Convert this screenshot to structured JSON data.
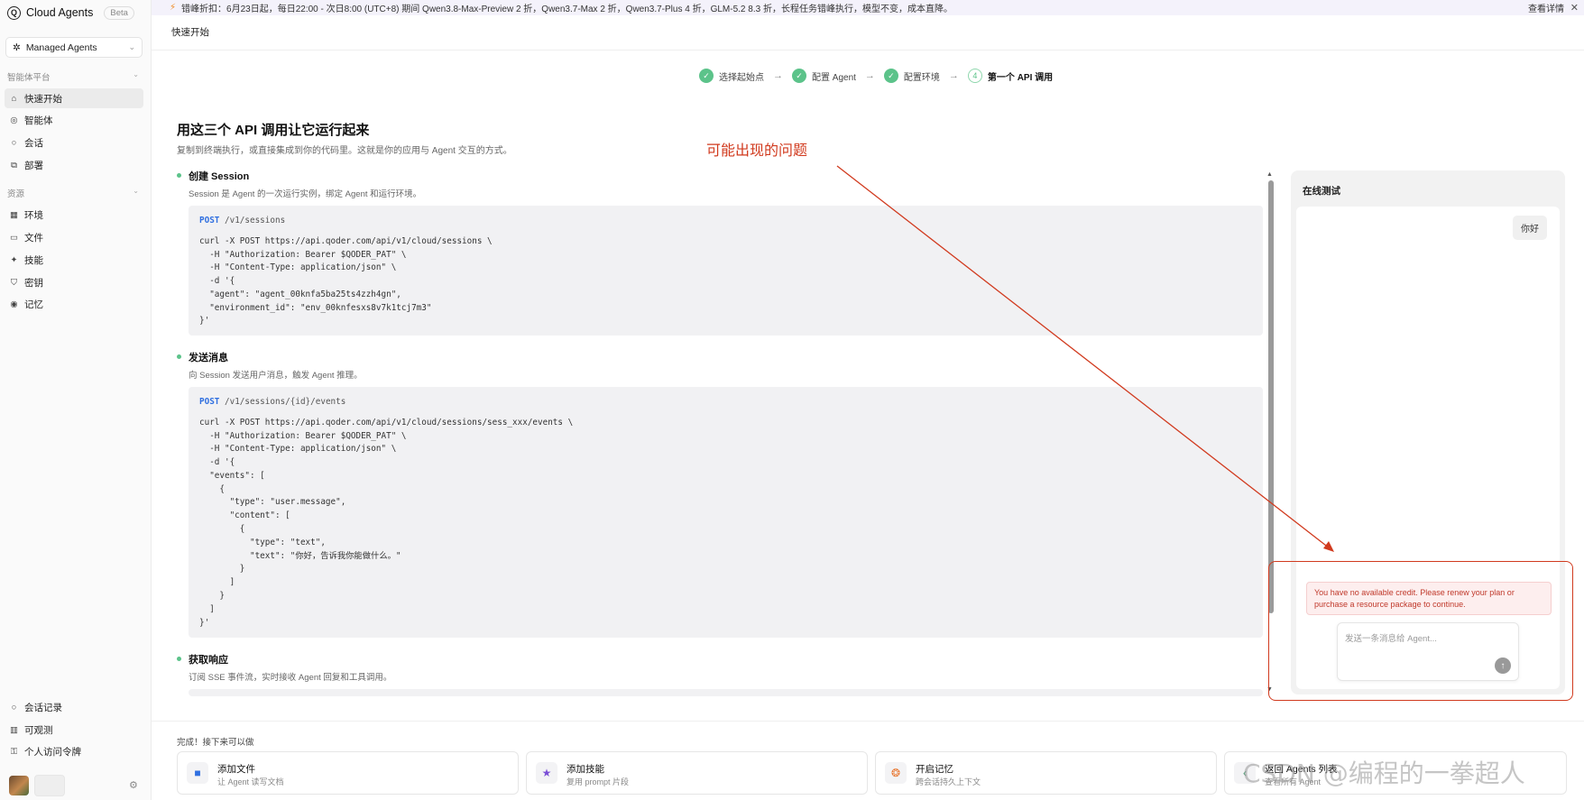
{
  "app": {
    "name": "Cloud Agents",
    "badge": "Beta"
  },
  "sidebar": {
    "workspace": "Managed Agents",
    "section1": "智能体平台",
    "items1": [
      {
        "label": "快速开始",
        "icon": "home-icon"
      },
      {
        "label": "智能体",
        "icon": "agent-icon"
      },
      {
        "label": "会话",
        "icon": "chat-icon"
      },
      {
        "label": "部署",
        "icon": "deploy-icon"
      }
    ],
    "section2": "资源",
    "items2": [
      {
        "label": "环境",
        "icon": "grid-icon"
      },
      {
        "label": "文件",
        "icon": "folder-icon"
      },
      {
        "label": "技能",
        "icon": "bulb-icon"
      },
      {
        "label": "密钥",
        "icon": "shield-icon"
      },
      {
        "label": "记忆",
        "icon": "memory-icon"
      }
    ],
    "bottom_items": [
      {
        "label": "会话记录",
        "icon": "chat-icon"
      },
      {
        "label": "可观测",
        "icon": "chart-icon"
      },
      {
        "label": "个人访问令牌",
        "icon": "key-icon"
      }
    ]
  },
  "banner": {
    "text": "错峰折扣：6月23日起，每日22:00 - 次日8:00 (UTC+8) 期间 Qwen3.8-Max-Preview 2 折，Qwen3.7-Max 2 折，Qwen3.7-Plus 4 折，GLM-5.2 8.3 折，长程任务错峰执行，模型不变，成本直降。",
    "detail": "查看详情"
  },
  "page_title": "快速开始",
  "stepper": [
    {
      "label": "选择起始点",
      "done": true
    },
    {
      "label": "配置 Agent",
      "done": true
    },
    {
      "label": "配置环境",
      "done": true
    },
    {
      "label": "第一个 API 调用",
      "num": "4",
      "done": false
    }
  ],
  "main": {
    "title": "用这三个 API 调用让它运行起来",
    "subtitle": "复制到终端执行，或直接集成到你的代码里。这就是你的应用与 Agent 交互的方式。",
    "steps": [
      {
        "title": "创建 Session",
        "desc": "Session 是 Agent 的一次运行实例，绑定 Agent 和运行环境。",
        "method": "POST",
        "path": "/v1/sessions",
        "code": "curl -X POST https://api.qoder.com/api/v1/cloud/sessions \\\n  -H \"Authorization: Bearer $QODER_PAT\" \\\n  -H \"Content-Type: application/json\" \\\n  -d '{\n  \"agent\": \"agent_00knfa5ba25ts4zzh4gn\",\n  \"environment_id\": \"env_00knfesxs8v7k1tcj7m3\"\n}'"
      },
      {
        "title": "发送消息",
        "desc": "向 Session 发送用户消息，触发 Agent 推理。",
        "method": "POST",
        "path": "/v1/sessions/{id}/events",
        "code": "curl -X POST https://api.qoder.com/api/v1/cloud/sessions/sess_xxx/events \\\n  -H \"Authorization: Bearer $QODER_PAT\" \\\n  -H \"Content-Type: application/json\" \\\n  -d '{\n  \"events\": [\n    {\n      \"type\": \"user.message\",\n      \"content\": [\n        {\n          \"type\": \"text\",\n          \"text\": \"你好，告诉我你能做什么。\"\n        }\n      ]\n    }\n  ]\n}'"
      },
      {
        "title": "获取响应",
        "desc": "订阅 SSE 事件流，实时接收 Agent 回复和工具调用。"
      }
    ]
  },
  "test_panel": {
    "title": "在线测试",
    "user_message": "你好",
    "error": "You have no available credit. Please renew your plan or purchase a resource package to continue.",
    "input_placeholder": "发送一条消息给 Agent..."
  },
  "annotation": {
    "text": "可能出现的问题",
    "color": "#d13a1e"
  },
  "next": {
    "title": "完成！接下来可以做",
    "cards": [
      {
        "title": "添加文件",
        "desc": "让 Agent 读写文档",
        "icon": "folder-icon"
      },
      {
        "title": "添加技能",
        "desc": "复用 prompt 片段",
        "icon": "star-icon"
      },
      {
        "title": "开启记忆",
        "desc": "跨会话持久上下文",
        "icon": "brain-icon"
      },
      {
        "title": "返回 Agents 列表",
        "desc": "查看所有 Agent",
        "icon": "back-icon"
      }
    ]
  },
  "watermark": "CSDN @编程的一拳超人"
}
